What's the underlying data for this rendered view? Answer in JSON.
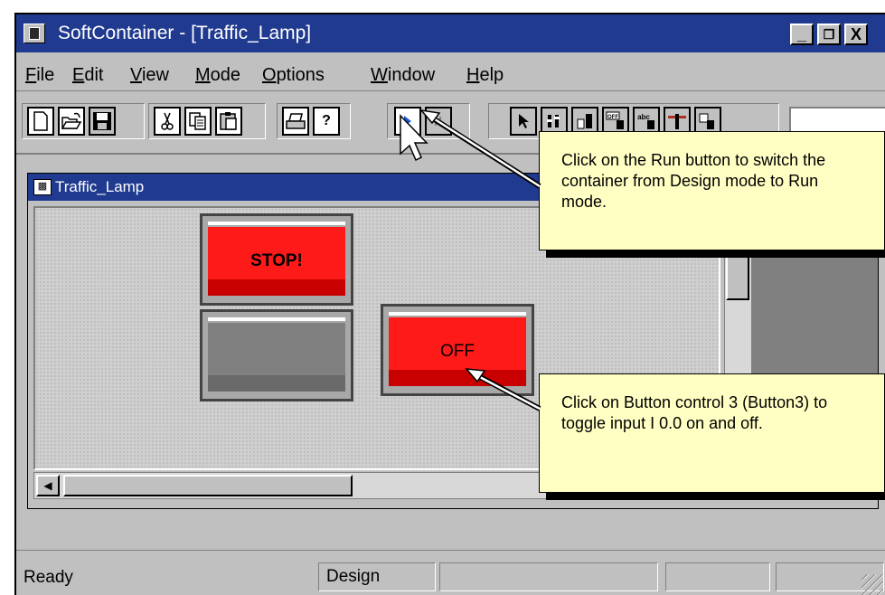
{
  "window": {
    "title": "SoftContainer - [Traffic_Lamp]",
    "controls": {
      "minimize": "_",
      "restore": "🗗",
      "close": "X"
    }
  },
  "menu": {
    "file": "File",
    "edit": "Edit",
    "view": "View",
    "mode": "Mode",
    "options": "Options",
    "window": "Window",
    "help": "Help"
  },
  "toolbar": {
    "buttons": [
      "new-icon",
      "open-icon",
      "save-icon",
      "cut-icon",
      "copy-icon",
      "paste-icon",
      "print-icon",
      "help-icon",
      "run-icon",
      "pause-icon",
      "pointer-icon",
      "switch-icon",
      "meter-icon",
      "off-button-icon",
      "text-icon",
      "slider-icon",
      "lamp-icon"
    ],
    "help_glyph": "?",
    "off_glyph": "OFF",
    "abc_glyph": "abc"
  },
  "child_window": {
    "title": "Traffic_Lamp"
  },
  "controls": {
    "stop_button": {
      "label": "STOP!",
      "color": "#ff0000"
    },
    "blank_button": {
      "label": "",
      "color": "#808080"
    },
    "button3": {
      "label": "OFF",
      "color": "#ff0000"
    }
  },
  "statusbar": {
    "ready": "Ready",
    "mode": "Design"
  },
  "callouts": {
    "run_button": "Click on the Run button to switch the container from Design mode to Run mode.",
    "button3": "Click on Button control 3 (Button3) to toggle input I 0.0 on and off."
  },
  "colors": {
    "titlebar": "#1f3a8f",
    "callout_bg": "#ffffc4",
    "chrome": "#c0c0c0"
  }
}
